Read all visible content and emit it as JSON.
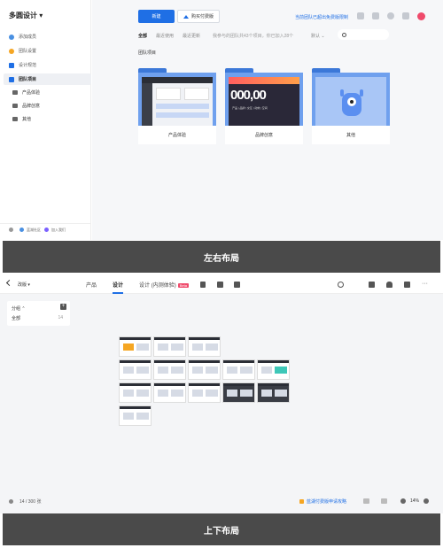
{
  "top": {
    "brand": "多圆设计",
    "sidebar": {
      "items": [
        {
          "label": "添加成员",
          "color": "#4a90e2"
        },
        {
          "label": "团队设置",
          "color": "#f5a623"
        },
        {
          "label": "设计规范",
          "color": "#1f6fe5"
        },
        {
          "label": "团队项目",
          "color": "#1f6fe5"
        }
      ],
      "sub_items": [
        "产品体验",
        "品牌创意",
        "其他"
      ],
      "footer": [
        "蓝湖社区",
        "加入我们"
      ]
    },
    "toolbar": {
      "new_label": "新建",
      "buy_label": "购买付费版",
      "notice": "当前团队已超出免费版限制"
    },
    "filters": [
      "全部",
      "最近使用",
      "最近更新"
    ],
    "filter_note": "我参与的团队共43个项目，你已加入28个",
    "sort_label": "默认",
    "section_title": "团队项目",
    "cards": [
      {
        "label": "产品体验"
      },
      {
        "label": "品牌创意",
        "preview_big": "000,00",
        "preview_small": "产品 | 品牌 | 交互 | 动效 | 空间"
      },
      {
        "label": "其他"
      }
    ]
  },
  "banners": [
    "左右布局",
    "上下布局"
  ],
  "bottom": {
    "project_label": "改版",
    "tabs": [
      "产品",
      "设计",
      "设计 (内测体验)"
    ],
    "beta_badge": "Beta",
    "group_panel": {
      "title": "分组",
      "row_label": "全部",
      "row_count": "14"
    },
    "page_counter": "14 / 300 张",
    "promo": "蓝湖付费版申请攻略",
    "zoom": "14%"
  },
  "colors": {
    "accent": "#1f6fe5",
    "folder": "#6fa0ee",
    "banner": "#4a4a4a"
  }
}
